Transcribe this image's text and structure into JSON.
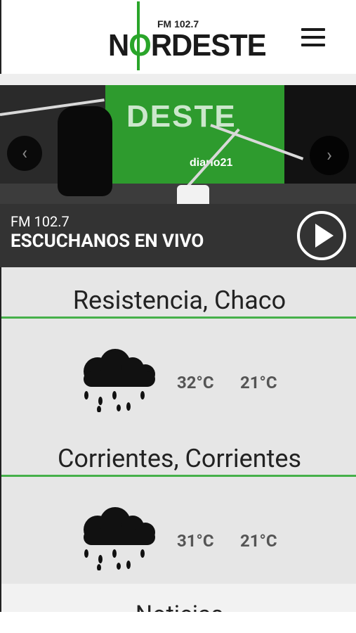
{
  "header": {
    "logo_fm": "FM 102.7",
    "logo_word_1": "N",
    "logo_word_o": "O",
    "logo_word_2": "RDESTE"
  },
  "hero": {
    "banner_text": "DESTE",
    "banner_sub": "diario21"
  },
  "live": {
    "frequency": "FM 102.7",
    "title": "ESCUCHANOS EN VIVO"
  },
  "weather": [
    {
      "city": "Resistencia, Chaco",
      "max": "32°C",
      "min": "21°C",
      "icon": "rain-cloud-icon"
    },
    {
      "city": "Corrientes, Corrientes",
      "max": "31°C",
      "min": "21°C",
      "icon": "rain-cloud-icon"
    }
  ],
  "next_section": "Noticias",
  "colors": {
    "accent": "#46b04a",
    "live_bar": "#333333",
    "weather_bg": "#e6e6e6"
  }
}
